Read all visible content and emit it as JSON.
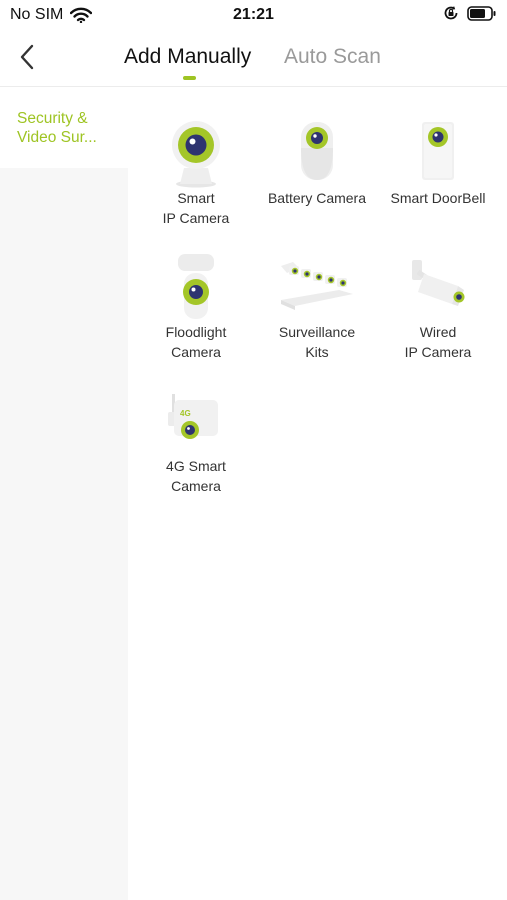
{
  "status_bar": {
    "carrier": "No SIM",
    "time": "21:21",
    "icons": [
      "wifi-icon",
      "orientation-lock-icon",
      "battery-icon"
    ]
  },
  "nav": {
    "back_icon": "chevron-left-icon",
    "tabs": [
      {
        "label": "Add Manually",
        "active": true
      },
      {
        "label": "Auto Scan",
        "active": false
      }
    ],
    "accent_color": "#9ec423"
  },
  "sidebar": {
    "items": [
      {
        "label": "Security &\nVideo Sur...",
        "selected": true
      }
    ]
  },
  "devices": [
    {
      "label": "Smart\nIP Camera",
      "icon": "smart-ip-camera-icon"
    },
    {
      "label": "Battery Camera",
      "icon": "battery-camera-icon"
    },
    {
      "label": "Smart DoorBell",
      "icon": "doorbell-icon"
    },
    {
      "label": "Floodlight\nCamera",
      "icon": "floodlight-camera-icon"
    },
    {
      "label": "Surveillance\nKits",
      "icon": "surveillance-kit-icon"
    },
    {
      "label": "Wired\nIP Camera",
      "icon": "wired-camera-icon"
    },
    {
      "label": "4G Smart\nCamera",
      "icon": "4g-camera-icon"
    }
  ],
  "badge_text": "4G"
}
